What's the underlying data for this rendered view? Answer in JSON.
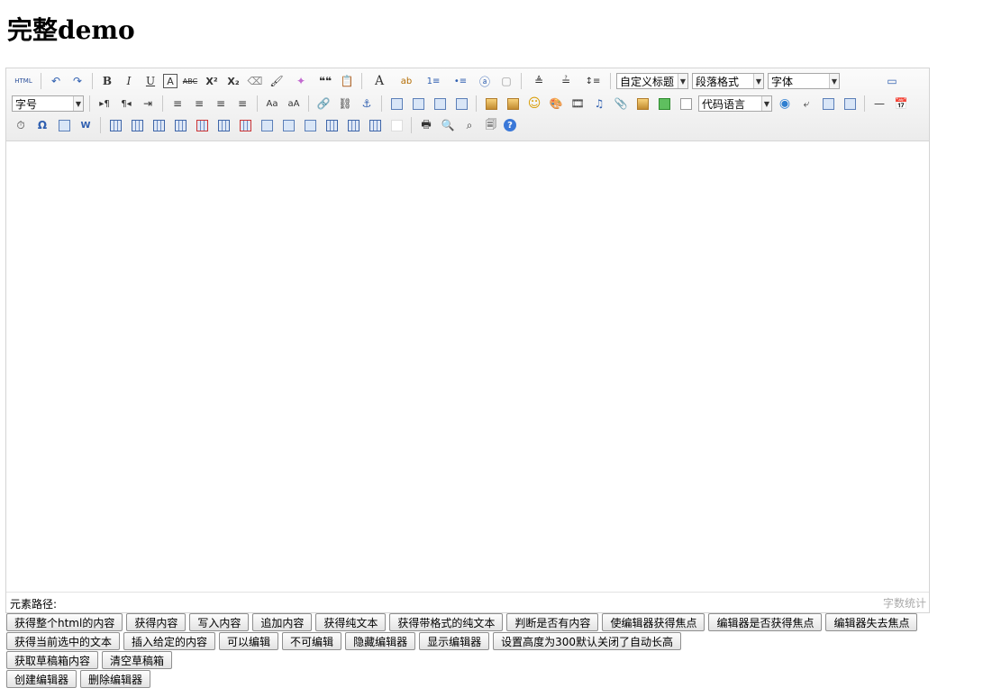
{
  "page": {
    "title": "完整demo"
  },
  "toolbar": {
    "selects": {
      "custom_heading": "自定义标题",
      "paragraph_format": "段落格式",
      "font_family": "字体",
      "font_size": "字号",
      "code_language": "代码语言"
    },
    "glyphs": {
      "html": "HTML",
      "undo": "↶",
      "redo": "↷",
      "bold": "B",
      "italic": "I",
      "underline": "U",
      "font_border": "A",
      "strike": "ABC",
      "superscript": "X²",
      "subscript": "X₂",
      "erase": "⌫",
      "format_brush": "🖌",
      "auto_type": "✦",
      "blockquote": "❝❝",
      "paste_plain": "📋",
      "fore_color": "A",
      "back_color": "ab",
      "ordered_list": "1≡",
      "unordered_list": "•≡",
      "select_all": "ⓐ",
      "clear_doc": "▢",
      "row_spacing_top": "≜",
      "row_spacing_bottom": "≟",
      "line_height": "↕≡",
      "preview": "▭",
      "dir_ltr": "▸¶",
      "dir_rtl": "¶◂",
      "indent": "⇥",
      "align_left": "≡",
      "align_center": "≡",
      "align_right": "≡",
      "align_justify": "≡",
      "to_upper": "Aa",
      "to_lower": "aA",
      "link": "🔗",
      "unlink": "⛓",
      "anchor": "⚓",
      "image_none": "▭",
      "image_left": "▭",
      "image_right": "▭",
      "image_center": "▭",
      "simple_upload": "🖼",
      "insert_image": "🖼",
      "emotion": "☺",
      "scrawl": "🎨",
      "insert_video": "🎞",
      "music": "♫",
      "attachment": "📎",
      "map": "🗺",
      "gmap": "🌐",
      "insert_frame": "▣",
      "insert_code": "▤",
      "webapp": "◉",
      "page_break": "⤶",
      "template": "▦",
      "background": "▨",
      "horizontal": "—",
      "date": "📅",
      "time": "⏱",
      "spechars": "Ω",
      "wordimage": "W",
      "inserttable": "▦",
      "deletetable": "⊠",
      "print": "🖶",
      "search": "🔍",
      "searchreplace": "⌕",
      "drafts": "🗐",
      "help": "?"
    }
  },
  "status": {
    "path_label": "元素路径:",
    "word_count": "字数统计"
  },
  "buttons": {
    "row1": [
      "获得整个html的内容",
      "获得内容",
      "写入内容",
      "追加内容",
      "获得纯文本",
      "获得带格式的纯文本",
      "判断是否有内容",
      "使编辑器获得焦点",
      "编辑器是否获得焦点",
      "编辑器失去焦点"
    ],
    "row2": [
      "获得当前选中的文本",
      "插入给定的内容",
      "可以编辑",
      "不可编辑",
      "隐藏编辑器",
      "显示编辑器",
      "设置高度为300默认关闭了自动长高"
    ],
    "row3": [
      "获取草稿箱内容",
      "清空草稿箱"
    ],
    "row4": [
      "创建编辑器",
      "删除编辑器"
    ]
  }
}
